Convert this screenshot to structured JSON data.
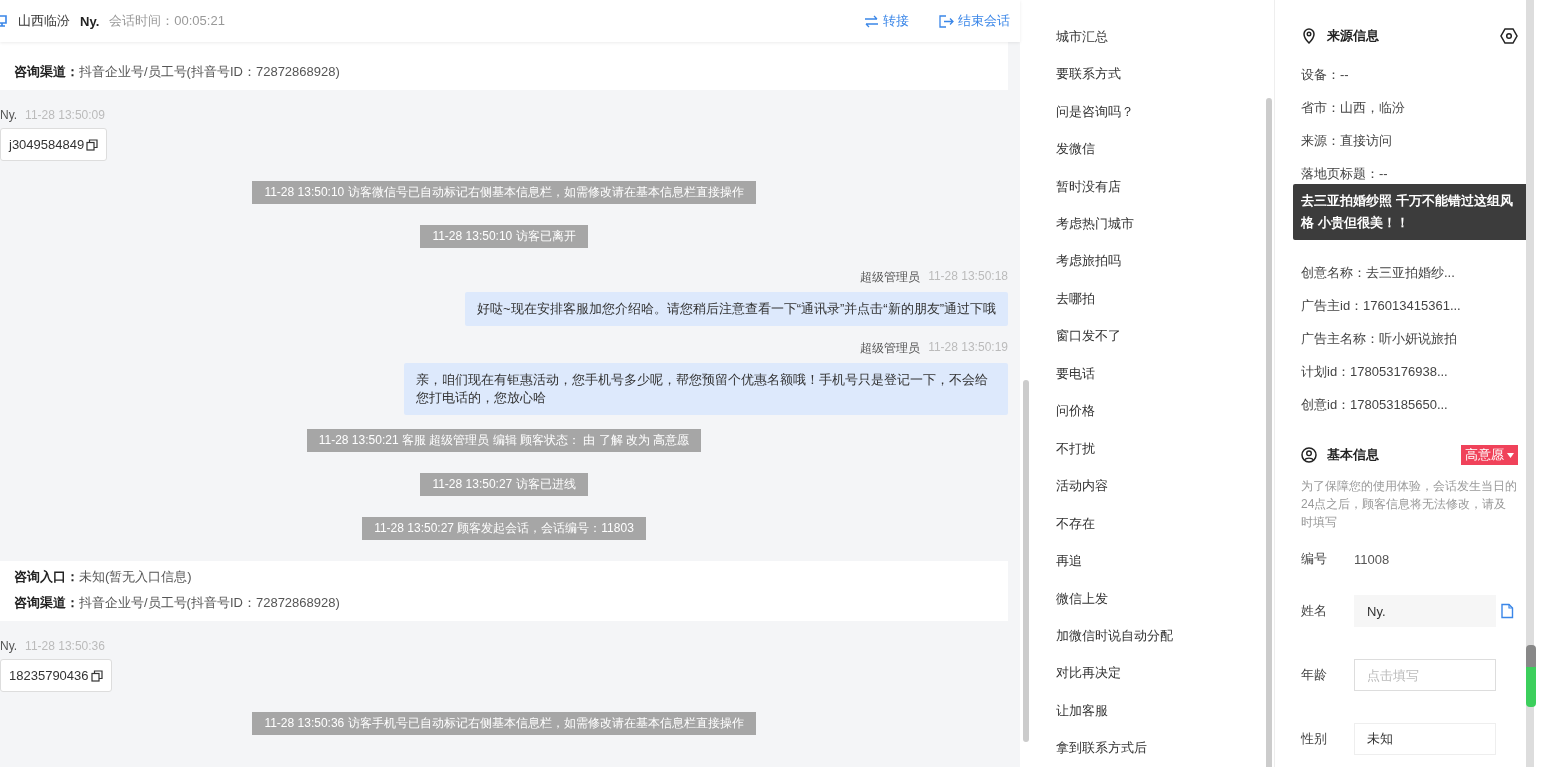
{
  "header": {
    "location": "山西临汾",
    "visitor": "Ny.",
    "session_time": "会话时间：00:05:21",
    "actions": [
      {
        "kind": "transfer",
        "label": "转接"
      },
      {
        "kind": "end",
        "label": "结束会话"
      }
    ]
  },
  "chat": [
    {
      "kind": "info_card",
      "lines": [
        {
          "label": "咨询渠道：",
          "value": "抖音企业号/员工号(抖音号ID：72872868928)"
        }
      ]
    },
    {
      "kind": "visitor",
      "name": "Ny.",
      "time": "11-28 13:50:09",
      "text": "j3049584849"
    },
    {
      "kind": "system",
      "text": "11-28 13:50:10 访客微信号已自动标记右侧基本信息栏，如需修改请在基本信息栏直接操作"
    },
    {
      "kind": "system",
      "text": "11-28 13:50:10 访客已离开"
    },
    {
      "kind": "agent",
      "name": "超级管理员",
      "time": "11-28 13:50:18",
      "text": "好哒~现在安排客服加您介绍哈。请您稍后注意查看一下“通讯录”并点击“新的朋友”通过下哦"
    },
    {
      "kind": "agent",
      "name": "超级管理员",
      "time": "11-28 13:50:19",
      "text": "亲，咱们现在有钜惠活动，您手机号多少呢，帮您预留个优惠名额哦！手机号只是登记一下，不会给您打电话的，您放心哈"
    },
    {
      "kind": "system",
      "text": "11-28 13:50:21 客服 超级管理员 编辑 顾客状态： 由 了解 改为 高意愿"
    },
    {
      "kind": "system",
      "text": "11-28 13:50:27 访客已进线"
    },
    {
      "kind": "system",
      "text": "11-28 13:50:27 顾客发起会话，会话编号：11803"
    },
    {
      "kind": "info_card",
      "lines": [
        {
          "label": "咨询入口：",
          "value": "未知(暂无入口信息)"
        },
        {
          "label": "咨询渠道：",
          "value": "抖音企业号/员工号(抖音号ID：72872868928)"
        }
      ]
    },
    {
      "kind": "visitor",
      "name": "Ny.",
      "time": "11-28 13:50:36",
      "text": "18235790436"
    },
    {
      "kind": "system",
      "text": "11-28 13:50:36 访客手机号已自动标记右侧基本信息栏，如需修改请在基本信息栏直接操作"
    }
  ],
  "quick_replies": [
    "城市汇总",
    "要联系方式",
    "问是咨询吗？",
    "发微信",
    "暂时没有店",
    "考虑热门城市",
    "考虑旅拍吗",
    "去哪拍",
    "窗口发不了",
    "要电话",
    "问价格",
    "不打扰",
    "活动内容",
    "不存在",
    "再追",
    "微信上发",
    "加微信时说自动分配",
    "对比再决定",
    "让加客服",
    "拿到联系方式后"
  ],
  "source_info": {
    "title": "来源信息",
    "rows_before": [
      "设备：--",
      "省市：山西，临汾",
      "来源：直接访问",
      "落地页标题：--"
    ],
    "tooltip": "去三亚拍婚纱照 千万不能错过这组风格 小贵但很美！！",
    "rows_after": [
      "创意名称：去三亚拍婚纱...",
      "广告主id：176013415361...",
      "广告主名称：听小妍说旅拍",
      "计划id：178053176938...",
      "创意id：178053185650..."
    ]
  },
  "basic_info": {
    "title": "基本信息",
    "status_tag": "高意愿",
    "note": "为了保障您的使用体验，会话发生当日的24点之后，顾客信息将无法修改，请及时填写",
    "fields": [
      {
        "kind": "text",
        "label": "编号",
        "value": "11008"
      },
      {
        "kind": "readonly",
        "label": "姓名",
        "value": "Ny."
      },
      {
        "kind": "input",
        "label": "年龄",
        "placeholder": "点击填写"
      },
      {
        "kind": "select",
        "label": "性别",
        "value": "未知"
      }
    ]
  }
}
